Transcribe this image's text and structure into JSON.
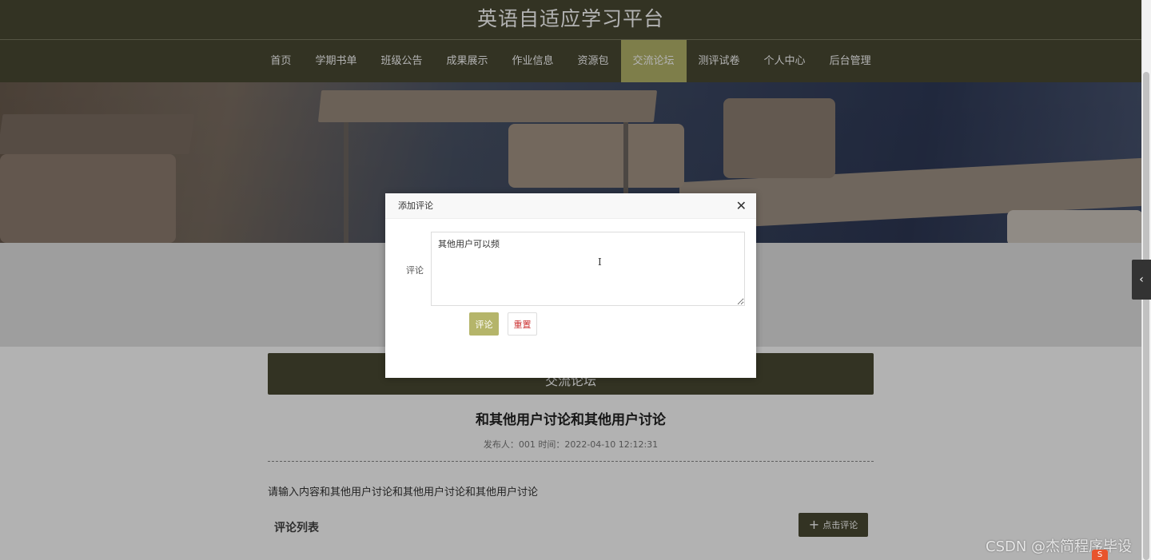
{
  "header": {
    "site_title": "英语自适应学习平台"
  },
  "nav": {
    "items": [
      {
        "label": "首页"
      },
      {
        "label": "学期书单"
      },
      {
        "label": "班级公告"
      },
      {
        "label": "成果展示"
      },
      {
        "label": "作业信息"
      },
      {
        "label": "资源包"
      },
      {
        "label": "交流论坛",
        "active": true
      },
      {
        "label": "测评试卷"
      },
      {
        "label": "个人中心"
      },
      {
        "label": "后台管理"
      }
    ]
  },
  "section": {
    "title": "交流论坛"
  },
  "post": {
    "title": "和其他用户讨论和其他用户讨论",
    "meta": "发布人：001 时间：2022-04-10 12:12:31",
    "content": "请输入内容和其他用户讨论和其他用户讨论和其他用户讨论"
  },
  "comments": {
    "title": "评论列表",
    "add_button": "点击评论"
  },
  "dialog": {
    "title": "添加评论",
    "close": "✕",
    "field_label": "评论",
    "textarea_value": "其他用户可以频",
    "submit_label": "评论",
    "reset_label": "重置"
  },
  "side_toggle": {
    "icon": "chevron-left-icon"
  },
  "watermark": "CSDN @杰简程序毕设",
  "ime_badge": "S",
  "colors": {
    "primary_dark": "#4a4a33",
    "accent": "#b5b56a",
    "reset_text": "#cc3333"
  }
}
